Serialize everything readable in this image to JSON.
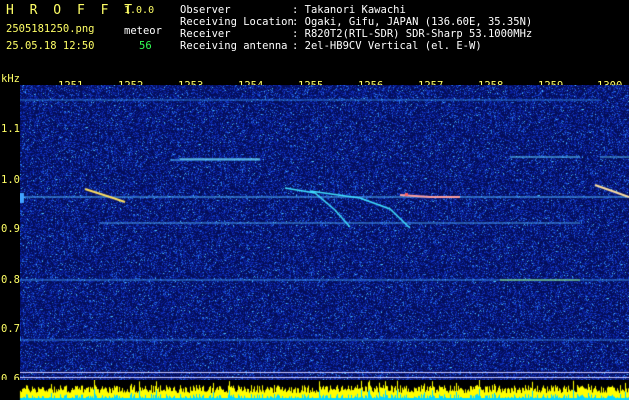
{
  "app": {
    "name": "H R O F F T",
    "version": "1.0.0"
  },
  "file": {
    "name": "2505181250.png",
    "datetime": "25.05.18 12:50"
  },
  "meteor": {
    "label": "meteor",
    "count": "56"
  },
  "info": [
    {
      "label": "Observer",
      "value": ": Takanori Kawachi"
    },
    {
      "label": "Receiving Location",
      "value": ": Ogaki, Gifu, JAPAN (136.60E, 35.35N)"
    },
    {
      "label": "Receiver",
      "value": ": R820T2(RTL-SDR) SDR-Sharp 53.1000MHz"
    },
    {
      "label": "Receiving antenna",
      "value": ": 2el-HB9CV Vertical (el. E-W)"
    }
  ],
  "yaxis": {
    "unit": "kHz",
    "ticks": [
      "1.1",
      "1.0",
      "0.9",
      "0.8",
      "0.7",
      "0.6"
    ]
  },
  "xaxis": {
    "ticks": [
      "1251",
      "1252",
      "1253",
      "1254",
      "1255",
      "1256",
      "1257",
      "1258",
      "1259",
      "1300"
    ]
  },
  "colors": {
    "yellow": "#ffff66",
    "white": "#ffffff",
    "green": "#33ff55",
    "background": "#000000",
    "noise": "#0a1a8c",
    "signal": "#40e0ff",
    "baseline": "#ffff00"
  }
}
